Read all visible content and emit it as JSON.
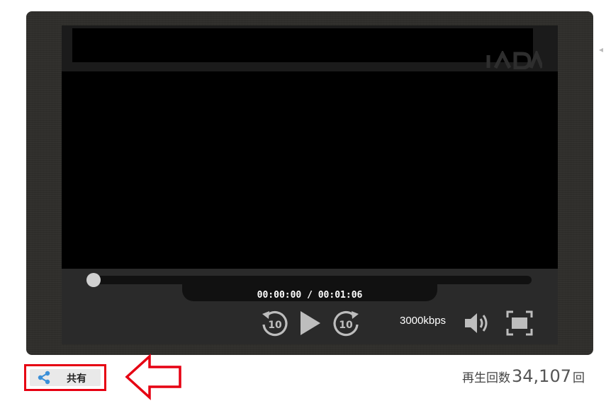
{
  "player": {
    "progress_fraction": 0.0,
    "time_display": "00:00:00 / 00:01:06",
    "bitrate": "3000kbps",
    "controls": {
      "rewind_seconds": "10",
      "forward_seconds": "10"
    },
    "icons": {
      "rewind": "rewind-10-icon",
      "play": "play-icon",
      "forward": "forward-10-icon",
      "volume": "volume-icon",
      "fullscreen": "fullscreen-icon"
    }
  },
  "share": {
    "label": "共有",
    "icon": "share-icon",
    "accent_color": "#3a8fd8"
  },
  "annotation": {
    "highlight_color": "#e60012"
  },
  "play_count": {
    "label": "再生回数",
    "value": "34,107",
    "unit": "回"
  }
}
